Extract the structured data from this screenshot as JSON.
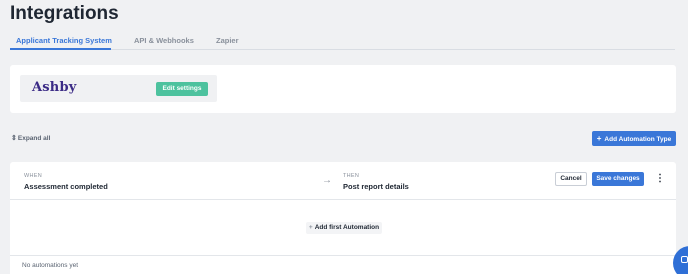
{
  "page": {
    "title": "Integrations"
  },
  "tabs": [
    {
      "label": "Applicant Tracking System",
      "active": true
    },
    {
      "label": "API & Webhooks",
      "active": false
    },
    {
      "label": "Zapier",
      "active": false
    }
  ],
  "integration": {
    "provider_name": "Ashby",
    "edit_label": "Edit settings"
  },
  "toolbar": {
    "expand_icon": "⇕",
    "expand_label": "Expand all",
    "add_type_icon": "+",
    "add_type_label": "Add Automation Type"
  },
  "automation": {
    "when_label": "WHEN",
    "when_value": "Assessment completed",
    "arrow_icon": "→",
    "then_label": "THEN",
    "then_value": "Post report details",
    "cancel_label": "Cancel",
    "save_label": "Save changes",
    "more_icon": "⋮",
    "add_first_icon": "+",
    "add_first_label": "Add first Automation",
    "empty_text": "No automations yet"
  },
  "colors": {
    "accent": "#3a77d8",
    "edit_button": "#4dc29e",
    "logo": "#3b2b86",
    "chat": "#2f6fd6"
  },
  "icons": [
    "expand-icon",
    "plus-icon",
    "arrow-right-icon",
    "more-vertical-icon",
    "chat-icon"
  ]
}
